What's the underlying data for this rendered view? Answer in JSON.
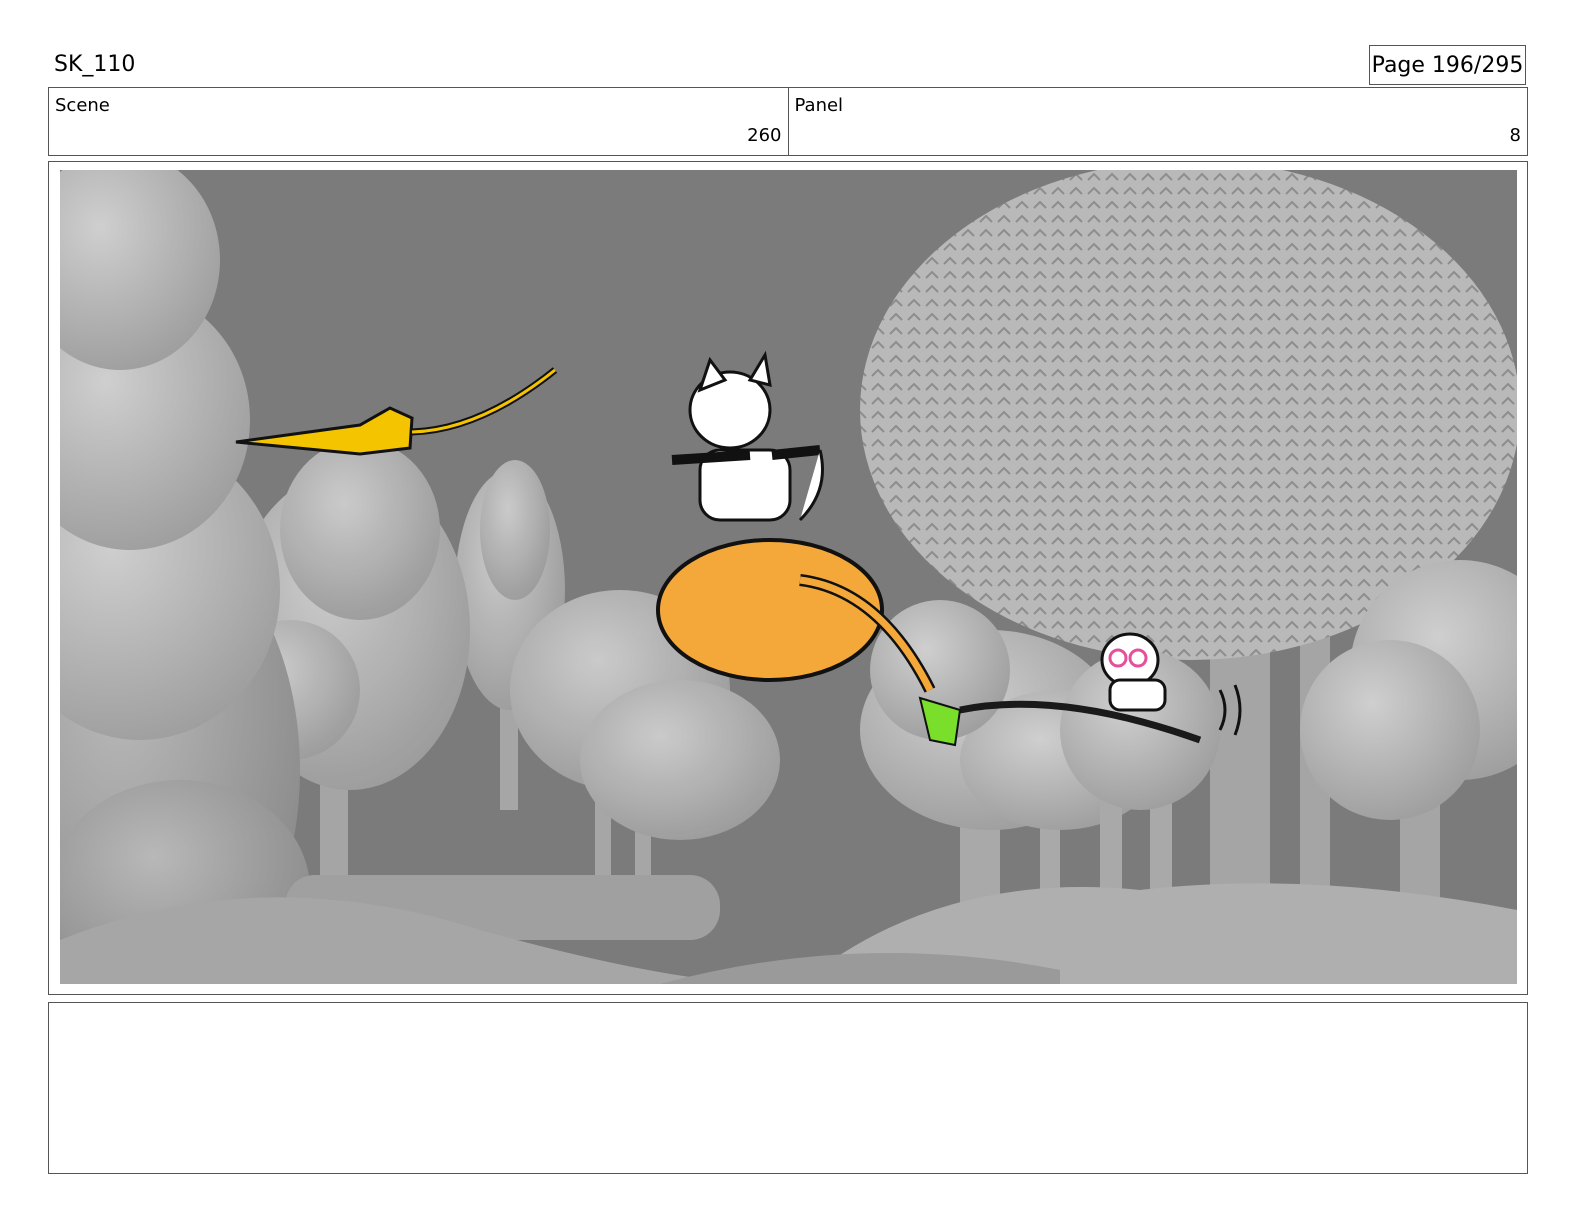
{
  "header": {
    "title": "SK_110",
    "page": "Page 196/295"
  },
  "info": {
    "scene_label": "Scene",
    "scene_value": "260",
    "panel_label": "Panel",
    "panel_value": "8"
  },
  "notes": {
    "text": ""
  }
}
